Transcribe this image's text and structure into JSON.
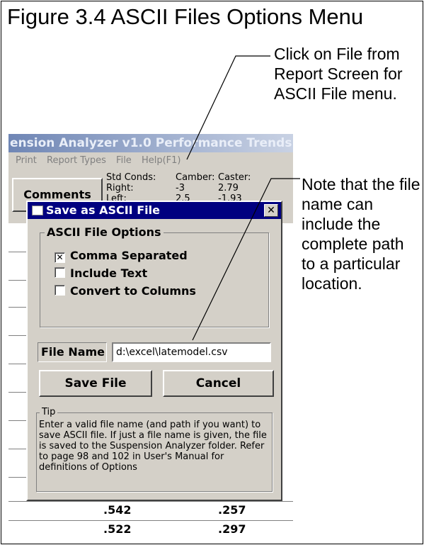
{
  "figure": {
    "title": "Figure 3.4 ASCII Files Options Menu",
    "callout_top": "Click on File from Report Screen for ASCII File menu.",
    "callout_right": "Note that the file name can include the complete path to a particular location."
  },
  "app": {
    "title": "ension Analyzer v1.0   Performance Trends   [",
    "menu": [
      "Print",
      "Report Types",
      "File",
      "Help(F1)"
    ],
    "comments_label": "Comments",
    "conds": {
      "col1": [
        "Std Conds:",
        "Right:",
        "Left:"
      ],
      "col2": [
        "Camber:",
        "-3",
        "2.5"
      ],
      "col3": [
        "Caster:",
        "2.79",
        "-1.93"
      ]
    }
  },
  "dialog": {
    "title": "Save as ASCII File",
    "close_label": "✕",
    "options_legend": "ASCII File Options",
    "options": [
      {
        "label": "Comma Separated",
        "checked": true
      },
      {
        "label": "Include Text",
        "checked": false
      },
      {
        "label": "Convert to Columns",
        "checked": false
      }
    ],
    "file_name_label": "File Name",
    "file_name_value": "d:\\excel\\latemodel.csv",
    "save_label": "Save File",
    "cancel_label": "Cancel",
    "tip_legend": "Tip",
    "tip_text": "Enter a valid file name (and path if you want) to save ASCII file.  If just a file name is given, the file is saved to the Suspension Analyzer folder.  Refer to page 98 and 102 in User's Manual for definitions of Options"
  },
  "table_rows": [
    {
      "c1": ".542",
      "c2": ".257"
    },
    {
      "c1": ".522",
      "c2": ".297"
    }
  ]
}
